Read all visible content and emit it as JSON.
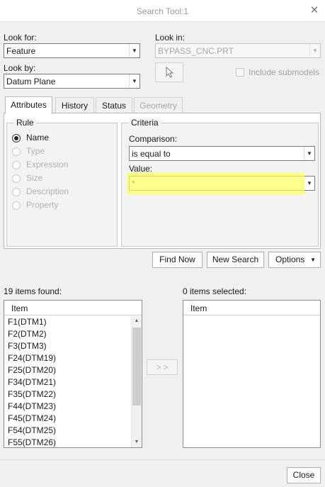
{
  "window": {
    "title": "Search Tool:1"
  },
  "look_for": {
    "label": "Look for:",
    "value": "Feature"
  },
  "look_in": {
    "label": "Look in:",
    "value": "BYPASS_CNC.PRT"
  },
  "look_by": {
    "label": "Look by:",
    "value": "Datum Plane"
  },
  "include_submodels": {
    "label": "Include submodels",
    "checked": false
  },
  "tabs": [
    {
      "label": "Attributes",
      "active": true
    },
    {
      "label": "History",
      "active": false
    },
    {
      "label": "Status",
      "active": false
    },
    {
      "label": "Geometry",
      "active": false,
      "disabled": true
    }
  ],
  "rule": {
    "title": "Rule",
    "options": [
      {
        "label": "Name",
        "selected": true
      },
      {
        "label": "Type",
        "selected": false
      },
      {
        "label": "Expression",
        "selected": false
      },
      {
        "label": "Size",
        "selected": false
      },
      {
        "label": "Description",
        "selected": false
      },
      {
        "label": "Property",
        "selected": false
      }
    ]
  },
  "criteria": {
    "title": "Criteria",
    "comparison_label": "Comparison:",
    "comparison_value": "is equal to",
    "value_label": "Value:",
    "value": "*",
    "highlight_color": "#ffff5a"
  },
  "actions": {
    "find_now": "Find Now",
    "new_search": "New Search",
    "options": "Options"
  },
  "found": {
    "label": "19 items found:",
    "column": "Item",
    "items": [
      "F1(DTM1)",
      "F2(DTM2)",
      "F3(DTM3)",
      "F24(DTM19)",
      "F25(DTM20)",
      "F34(DTM21)",
      "F35(DTM22)",
      "F44(DTM23)",
      "F45(DTM24)",
      "F54(DTM25)",
      "F55(DTM26)"
    ]
  },
  "transfer_button": "> >",
  "selected": {
    "label": "0 items selected:",
    "column": "Item"
  },
  "close_button": "Close"
}
